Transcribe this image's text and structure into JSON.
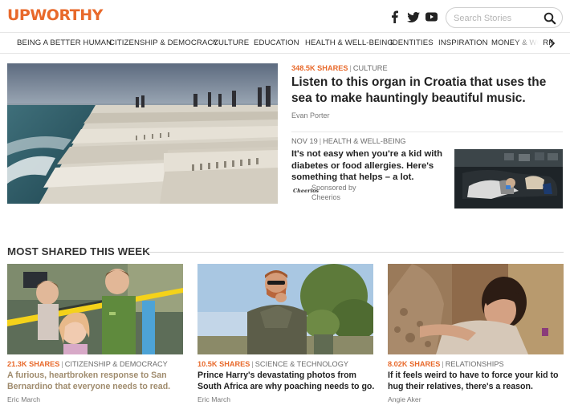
{
  "brand": {
    "logo": "UPWORTHY",
    "accent": "#e8692b"
  },
  "header": {
    "social_icons": [
      "facebook-icon",
      "twitter-icon",
      "youtube-icon"
    ],
    "search_placeholder": "Search Stories"
  },
  "nav": {
    "items": [
      "BEING A BETTER HUMAN",
      "CITIZENSHIP & DEMOCRACY",
      "CULTURE",
      "EDUCATION",
      "HEALTH & WELL-BEING",
      "IDENTITIES",
      "INSPIRATION",
      "MONEY & WORK"
    ]
  },
  "hero": {
    "shares": "348.5K SHARES",
    "category": "CULTURE",
    "title": "Listen to this organ in Croatia that uses the sea to make hauntingly beautiful music.",
    "author": "Evan Porter"
  },
  "secondary": {
    "date": "NOV 19",
    "category": "HEALTH & WELL-BEING",
    "title": "It's not easy when you're a kid with diabetes or food allergies. Here's something that helps – a lot.",
    "sponsor_logo": "Cheerios",
    "sponsor_line1": "Sponsored by",
    "sponsor_line2": "Cheerios"
  },
  "most_shared": {
    "heading": "MOST SHARED THIS WEEK",
    "cards": [
      {
        "shares": "21.3K SHARES",
        "category": "CITIZENSHIP & DEMOCRACY",
        "title": "A furious, heartbroken response to San Bernardino that everyone needs to read.",
        "author": "Eric March",
        "title_color": "#a08c6e"
      },
      {
        "shares": "10.5K SHARES",
        "category": "SCIENCE & TECHNOLOGY",
        "title": "Prince Harry's devastating photos from South Africa are why poaching needs to go.",
        "author": "Eric March",
        "title_color": "#222222"
      },
      {
        "shares": "8.02K SHARES",
        "category": "RELATIONSHIPS",
        "title": "If it feels weird to have to force your kid to hug their relatives, there's a reason.",
        "author": "Angie Aker",
        "title_color": "#222222"
      }
    ]
  }
}
